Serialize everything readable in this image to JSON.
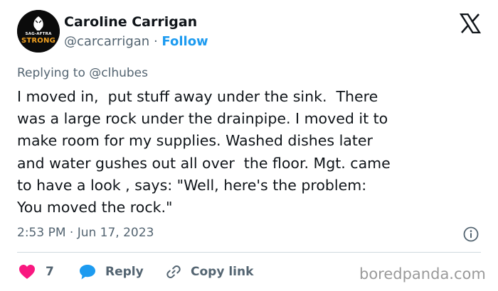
{
  "author": {
    "display_name": "Caroline Carrigan",
    "handle": "@carcarrigan",
    "separator": "·",
    "follow_label": "Follow",
    "avatar_text_top": "SAG-AFTRA",
    "avatar_text_bottom": "STRONG"
  },
  "reply_context": {
    "prefix": "Replying to",
    "mention": "@clhubes"
  },
  "tweet": {
    "lines": [
      "I moved in,  put stuff away under the sink.  There",
      "was a large rock under the drainpipe. I moved it to",
      "make room for my supplies. Washed dishes later",
      "and water gushes out all over  the floor. Mgt. came",
      "to have a look , says: \"Well, here's the problem:",
      "You moved the rock.\""
    ],
    "timestamp": "2:53 PM · Jun 17, 2023"
  },
  "actions": {
    "like_count": "7",
    "reply_label": "Reply",
    "copy_label": "Copy link"
  },
  "watermark": "boredpanda.com",
  "icons": {
    "brand": "x-logo-icon",
    "info": "info-icon",
    "like": "heart-icon",
    "reply": "speech-bubble-icon",
    "copy": "link-icon"
  },
  "colors": {
    "text": "#0f1419",
    "muted": "#536471",
    "link": "#1d9bf0",
    "like": "#f91880",
    "divider": "#cfd9de",
    "avatar_accent": "#f0a020"
  }
}
